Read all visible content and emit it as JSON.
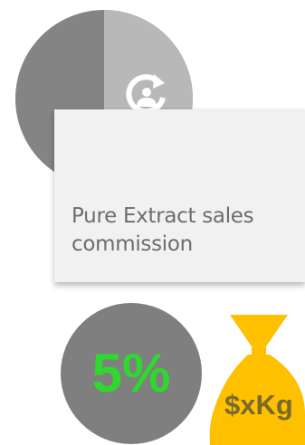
{
  "card": {
    "title": "Pure Extract sales commission"
  },
  "commission": {
    "percent_label": "5%"
  },
  "bag": {
    "label": "$xKg"
  },
  "icons": {
    "refresh": "refresh-person-icon",
    "bag": "money-bag-icon"
  },
  "colors": {
    "circle_dark": "#848484",
    "circle_light": "#b8b8b8",
    "card_bg": "#f1f1f1",
    "title_text": "#6d6d6d",
    "pct_circle": "#7f7f7f",
    "pct_text": "#2fd82f",
    "bag_fill": "#ffc000",
    "bag_text": "#7a6a2a"
  }
}
